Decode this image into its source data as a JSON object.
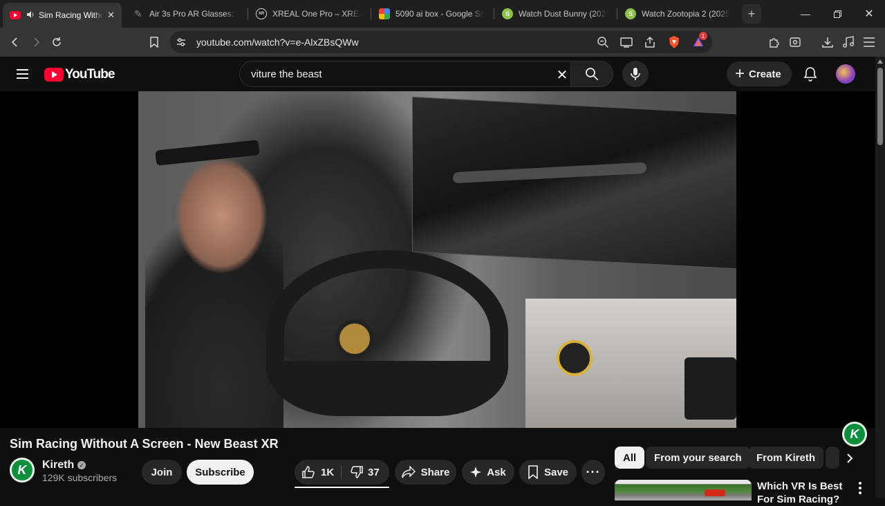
{
  "browser": {
    "tabs": [
      {
        "title": "Sim Racing Witho",
        "active": true,
        "favicon": "youtube-icon",
        "audio": true
      },
      {
        "title": "Air 3s Pro AR Glasses: 2",
        "favicon": "viture-icon"
      },
      {
        "title": "XREAL One Pro – XREAL",
        "favicon": "xreal-icon"
      },
      {
        "title": "5090 ai box - Google Sh",
        "favicon": "google-shopping-icon"
      },
      {
        "title": "Watch Dust Bunny (2025",
        "favicon": "stremio-icon"
      },
      {
        "title": "Watch Zootopia 2 (2025",
        "favicon": "stremio-icon"
      }
    ],
    "url": "youtube.com/watch?v=e-AlxZBsQWw",
    "rewards_badge": "1"
  },
  "youtube": {
    "logo_text": "YouTube",
    "search_query": "viture the beast",
    "create_label": "Create",
    "channel_watermark": "K"
  },
  "video": {
    "title": "Sim Racing Without A Screen - New Beast XR",
    "channel": "Kireth",
    "channel_initial": "K",
    "subscribers": "129K subscribers",
    "join_label": "Join",
    "subscribe_label": "Subscribe",
    "likes": "1K",
    "dislikes": "37",
    "share_label": "Share",
    "ask_label": "Ask",
    "save_label": "Save"
  },
  "sidebar": {
    "chips": [
      "All",
      "From your search",
      "From Kireth"
    ],
    "related": [
      {
        "title": "Which VR Is Best For Sim Racing?"
      }
    ]
  },
  "colors": {
    "youtube_red": "#ff0033",
    "channel_green": "#0a8f3a",
    "background": "#0f0f0f"
  }
}
